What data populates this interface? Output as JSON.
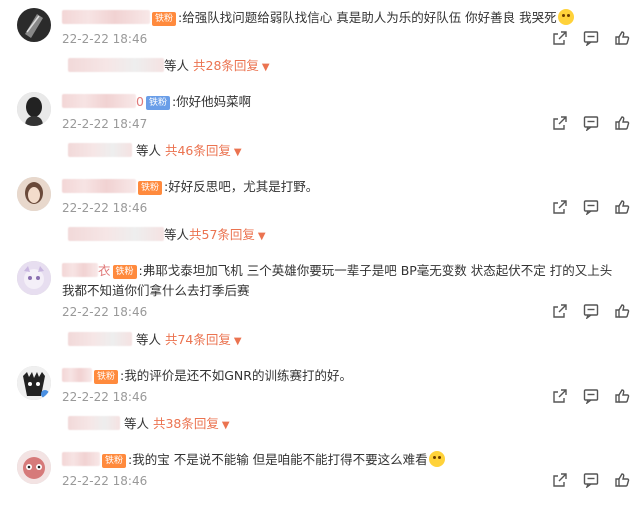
{
  "comments": [
    {
      "name_tail": "",
      "badge": "铁粉",
      "text": ":给强队找问题给弱队找信心 真是助人为乐的好队伍 你好善良 我哭死",
      "text2": "",
      "time": "22-2-22 18:46",
      "replies_tail": "等人",
      "replies_count": "共28条回复"
    },
    {
      "name_tail": "0",
      "badge": "铁粉",
      "text": ":你好他妈菜啊",
      "text2": "",
      "time": "22-2-22 18:47",
      "replies_tail": "等人",
      "replies_count": "共46条回复"
    },
    {
      "name_tail": "",
      "badge": "铁粉",
      "text": ":好好反思吧，尤其是打野。",
      "text2": "",
      "time": "22-2-22 18:46",
      "replies_tail": "等人",
      "replies_count": "共57条回复"
    },
    {
      "name_tail": "衣",
      "badge": "铁粉",
      "text": ":弗耶戈泰坦加飞机  三个英雄你要玩一辈子是吧  BP毫无变数  状态起伏不定  打的又上头",
      "text2": "我都不知道你们拿什么去打季后赛",
      "time": "22-2-22 18:46",
      "replies_tail": "等人",
      "replies_count": "共74条回复"
    },
    {
      "name_tail": "",
      "badge": "铁粉",
      "text": ":我的评价是还不如GNR的训练赛打的好。",
      "text2": "",
      "time": "22-2-22 18:46",
      "replies_tail": "等人",
      "replies_count": "共38条回复"
    },
    {
      "name_tail": "",
      "badge": "铁粉",
      "text": ":我的宝 不是说不能输 但是咱能不能打得不要这么难看",
      "text2": "",
      "time": "22-2-22 18:46",
      "replies_tail": "",
      "replies_count": ""
    }
  ],
  "icons": [
    "share-icon",
    "comment-icon",
    "like-icon"
  ],
  "colors": {
    "reply_accent": "#eb7350",
    "time": "#999999",
    "badge_fan": "#ff8a3d",
    "badge_iron": "#6a9ee8"
  }
}
